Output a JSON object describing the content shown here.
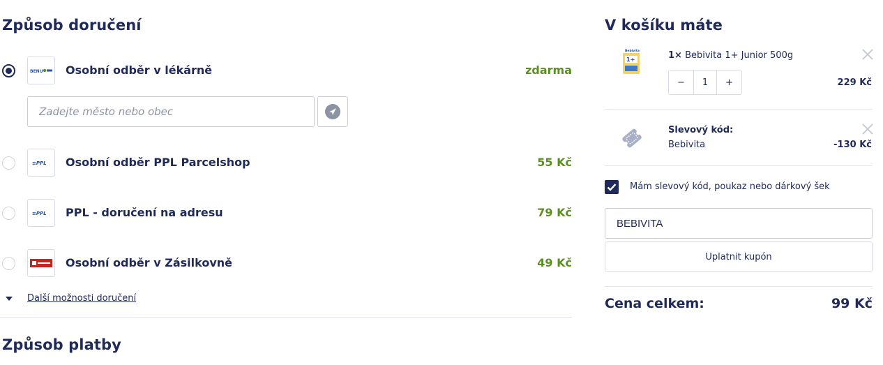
{
  "delivery": {
    "heading": "Způsob doručení",
    "options": [
      {
        "label": "Osobní odběr v lékárně",
        "price": "zdarma",
        "selected": true,
        "logo": "pharmacy-logo"
      },
      {
        "label": "Osobní odběr PPL Parcelshop",
        "price": "55 Kč",
        "selected": false,
        "logo": "ppl-logo"
      },
      {
        "label": "PPL - doručení na adresu",
        "price": "79 Kč",
        "selected": false,
        "logo": "ppl-logo"
      },
      {
        "label": "Osobní odběr v Zásilkovně",
        "price": "49 Kč",
        "selected": false,
        "logo": "zasilkovna-logo"
      }
    ],
    "city_placeholder": "Zadejte město nebo obec",
    "more_link": "Další možnosti doručení"
  },
  "payment": {
    "heading": "Způsob platby"
  },
  "cart": {
    "heading": "V košíku máte",
    "item": {
      "qty_prefix": "1×",
      "name": "Bebivita 1+ Junior 500g",
      "quantity": "1",
      "minus": "−",
      "plus": "+",
      "price": "229 Kč"
    },
    "discount": {
      "title": "Slevový kód:",
      "code": "Bebivita",
      "value": "-130 Kč"
    },
    "checkbox_label": "Mám slevový kód, poukaz nebo dárkový šek",
    "checkbox_checked": true,
    "code_input_value": "BEBIVITA",
    "apply_button": "Uplatnit kupón",
    "total_label": "Cena celkem:",
    "total_value": "99 Kč"
  },
  "colors": {
    "primary": "#1f2a5a",
    "price_green": "#5b8f22",
    "border": "#d7dbe3"
  }
}
